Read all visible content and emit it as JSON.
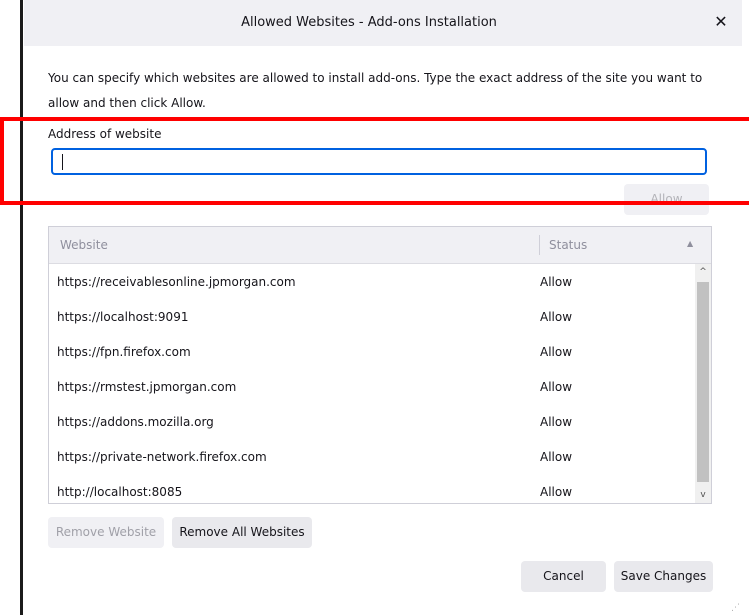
{
  "window": {
    "title": "Allowed Websites - Add-ons Installation",
    "close_glyph": "✕"
  },
  "description": "You can specify which websites are allowed to install add-ons. Type the exact address of the site you want to allow and then click Allow.",
  "address": {
    "label": "Address of website",
    "value": "",
    "placeholder": ""
  },
  "allow_button": {
    "label": "Allow",
    "enabled": false
  },
  "table": {
    "columns": [
      "Website",
      "Status"
    ],
    "sort_indicator": "▲",
    "rows": [
      {
        "website": "https://receivablesonline.jpmorgan.com",
        "status": "Allow"
      },
      {
        "website": "https://localhost:9091",
        "status": "Allow"
      },
      {
        "website": "https://fpn.firefox.com",
        "status": "Allow"
      },
      {
        "website": "https://rmstest.jpmorgan.com",
        "status": "Allow"
      },
      {
        "website": "https://addons.mozilla.org",
        "status": "Allow"
      },
      {
        "website": "https://private-network.firefox.com",
        "status": "Allow"
      },
      {
        "website": "http://localhost:8085",
        "status": "Allow"
      }
    ],
    "scroll_up_glyph": "^",
    "scroll_down_glyph": "v"
  },
  "buttons": {
    "remove_website": "Remove Website",
    "remove_all": "Remove All Websites",
    "cancel": "Cancel",
    "save": "Save Changes"
  },
  "colors": {
    "accent": "#0061e0",
    "highlight": "#ff0000"
  }
}
